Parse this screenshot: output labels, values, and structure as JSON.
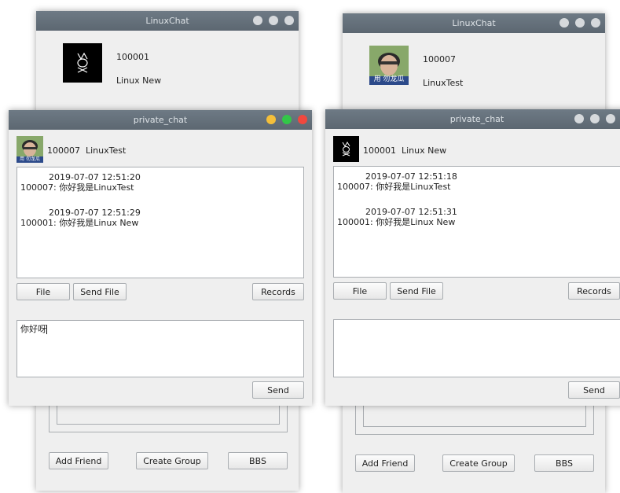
{
  "main_windows": [
    {
      "title": "LinuxChat",
      "user_id": "100001",
      "user_name": "Linux New",
      "buttons": {
        "add_friend": "Add Friend",
        "create_group": "Create Group",
        "bbs": "BBS"
      }
    },
    {
      "title": "LinuxChat",
      "user_id": "100007",
      "user_name": "LinuxTest",
      "avatar_caption": "用 勿龙瓜",
      "buttons": {
        "add_friend": "Add Friend",
        "create_group": "Create Group",
        "bbs": "BBS"
      }
    }
  ],
  "chat_windows": [
    {
      "title": "private_chat",
      "peer_label": "100007  LinuxTest",
      "avatar_caption": "用 勿龙瓜",
      "messages": [
        {
          "time": "2019-07-07 12:51:20",
          "text": "100007:  你好我是LinuxTest"
        },
        {
          "time": "2019-07-07 12:51:29",
          "text": "100001:  你好我是Linux New"
        }
      ],
      "buttons": {
        "file": "File",
        "send_file": "Send File",
        "records": "Records",
        "send": "Send"
      },
      "input_value": "你好呀"
    },
    {
      "title": "private_chat",
      "peer_label": "100001  Linux New",
      "messages": [
        {
          "time": "2019-07-07 12:51:18",
          "text": "100007:  你好我是LinuxTest"
        },
        {
          "time": "2019-07-07 12:51:31",
          "text": "100001:  你好我是Linux New"
        }
      ],
      "buttons": {
        "file": "File",
        "send_file": "Send File",
        "records": "Records",
        "send": "Send"
      },
      "input_value": ""
    }
  ],
  "colors": {
    "titlebar": "#5c6771",
    "window_bg": "#efefef",
    "close_red": "#f0483e",
    "min_yellow": "#f4bf3a",
    "max_green": "#33c748"
  }
}
